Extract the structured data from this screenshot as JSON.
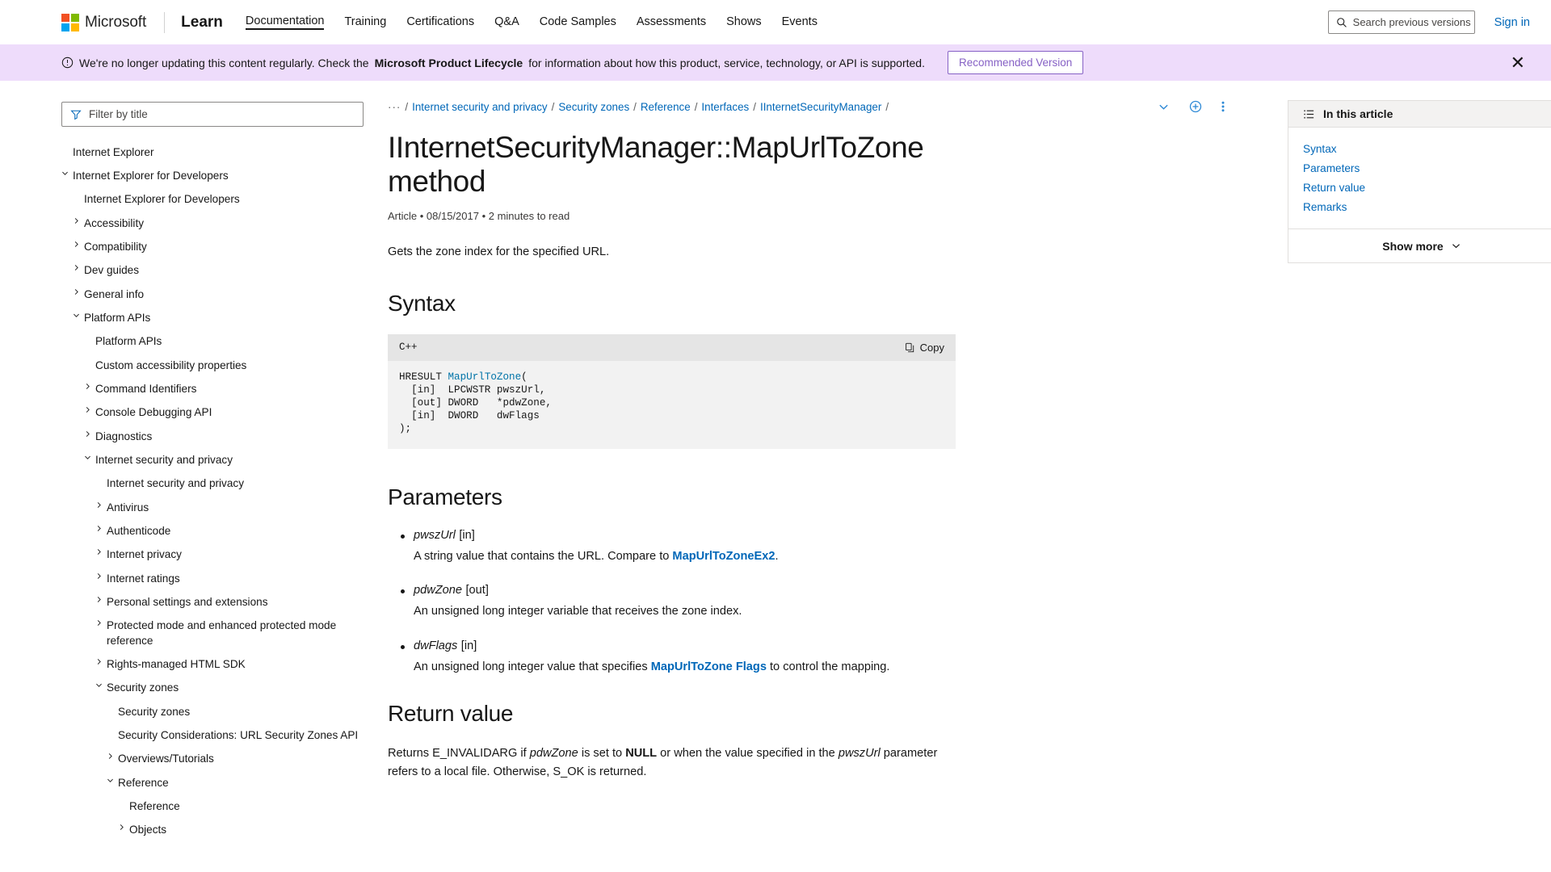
{
  "header": {
    "brand_name": "Microsoft",
    "product": "Learn",
    "logo_colors": [
      "#f25022",
      "#7fba00",
      "#00a4ef",
      "#ffb900"
    ],
    "nav": [
      {
        "label": "Documentation",
        "active": true
      },
      {
        "label": "Training",
        "active": false
      },
      {
        "label": "Certifications",
        "active": false
      },
      {
        "label": "Q&A",
        "active": false
      },
      {
        "label": "Code Samples",
        "active": false
      },
      {
        "label": "Assessments",
        "active": false
      },
      {
        "label": "Shows",
        "active": false
      },
      {
        "label": "Events",
        "active": false
      }
    ],
    "search_placeholder": "Search previous versions",
    "search_value": "",
    "sign_in": "Sign in"
  },
  "banner": {
    "text_before": "We're no longer updating this content regularly. Check the",
    "link": "Microsoft Product Lifecycle",
    "text_after": "for information about how this product, service, technology, or API is supported.",
    "button": "Recommended Version",
    "close": "✕",
    "background": "#eedcfb",
    "accent": "#8661c5"
  },
  "sidebar": {
    "filter_placeholder": "Filter by title",
    "filter_value": "",
    "items": [
      {
        "label": "Internet Explorer",
        "depth": 0,
        "chevron": "none"
      },
      {
        "label": "Internet Explorer for Developers",
        "depth": 0,
        "chevron": "down"
      },
      {
        "label": "Internet Explorer for Developers",
        "depth": 1,
        "chevron": "none"
      },
      {
        "label": "Accessibility",
        "depth": 1,
        "chevron": "right"
      },
      {
        "label": "Compatibility",
        "depth": 1,
        "chevron": "right"
      },
      {
        "label": "Dev guides",
        "depth": 1,
        "chevron": "right"
      },
      {
        "label": "General info",
        "depth": 1,
        "chevron": "right"
      },
      {
        "label": "Platform APIs",
        "depth": 1,
        "chevron": "down"
      },
      {
        "label": "Platform APIs",
        "depth": 2,
        "chevron": "none"
      },
      {
        "label": "Custom accessibility properties",
        "depth": 2,
        "chevron": "none"
      },
      {
        "label": "Command Identifiers",
        "depth": 2,
        "chevron": "right"
      },
      {
        "label": "Console Debugging API",
        "depth": 2,
        "chevron": "right"
      },
      {
        "label": "Diagnostics",
        "depth": 2,
        "chevron": "right"
      },
      {
        "label": "Internet security and privacy",
        "depth": 2,
        "chevron": "down"
      },
      {
        "label": "Internet security and privacy",
        "depth": 3,
        "chevron": "none"
      },
      {
        "label": "Antivirus",
        "depth": 3,
        "chevron": "right"
      },
      {
        "label": "Authenticode",
        "depth": 3,
        "chevron": "right"
      },
      {
        "label": "Internet privacy",
        "depth": 3,
        "chevron": "right"
      },
      {
        "label": "Internet ratings",
        "depth": 3,
        "chevron": "right"
      },
      {
        "label": "Personal settings and extensions",
        "depth": 3,
        "chevron": "right"
      },
      {
        "label": "Protected mode and enhanced protected mode reference",
        "depth": 3,
        "chevron": "right"
      },
      {
        "label": "Rights-managed HTML SDK",
        "depth": 3,
        "chevron": "right"
      },
      {
        "label": "Security zones",
        "depth": 3,
        "chevron": "down"
      },
      {
        "label": "Security zones",
        "depth": 4,
        "chevron": "none"
      },
      {
        "label": "Security Considerations: URL Security Zones API",
        "depth": 4,
        "chevron": "none"
      },
      {
        "label": "Overviews/Tutorials",
        "depth": 4,
        "chevron": "right"
      },
      {
        "label": "Reference",
        "depth": 4,
        "chevron": "down"
      },
      {
        "label": "Reference",
        "depth": 5,
        "chevron": "none"
      },
      {
        "label": "Objects",
        "depth": 5,
        "chevron": "right"
      }
    ]
  },
  "article": {
    "breadcrumb": {
      "ellipsis": "···",
      "separator": "/",
      "items": [
        "Internet security and privacy",
        "Security zones",
        "Reference",
        "Interfaces",
        "IInternetSecurityManager"
      ]
    },
    "title": "IInternetSecurityManager::MapUrlToZone method",
    "meta": "Article • 08/15/2017 • 2 minutes to read",
    "lead": "Gets the zone index for the specified URL.",
    "syntax": {
      "heading": "Syntax",
      "language": "C++",
      "copy_label": "Copy",
      "code_prefix": "HRESULT ",
      "code_fn": "MapUrlToZone",
      "code_rest": "(\n  [in]  LPCWSTR pwszUrl,\n  [out] DWORD   *pdwZone,\n  [in]  DWORD   dwFlags\n);"
    },
    "parameters": {
      "heading": "Parameters",
      "items": [
        {
          "name": "pwszUrl",
          "direction": "[in]",
          "desc_before": "A string value that contains the URL. Compare to ",
          "desc_link": "MapUrlToZoneEx2",
          "desc_after": "."
        },
        {
          "name": "pdwZone",
          "direction": "[out]",
          "desc_before": "An unsigned long integer variable that receives the zone index.",
          "desc_link": "",
          "desc_after": ""
        },
        {
          "name": "dwFlags",
          "direction": "[in]",
          "desc_before": "An unsigned long integer value that specifies ",
          "desc_link": "MapUrlToZone Flags",
          "desc_after": " to control the mapping."
        }
      ]
    },
    "return_value": {
      "heading": "Return value",
      "text_1": "Returns E_INVALIDARG if ",
      "em_1": "pdwZone",
      "text_2": " is set to ",
      "strong_1": "NULL",
      "text_3": " or when the value specified in the ",
      "em_2": "pwszUrl",
      "text_4": " parameter refers to a local file. Otherwise, S_OK is returned."
    }
  },
  "toc": {
    "heading": "In this article",
    "links": [
      "Syntax",
      "Parameters",
      "Return value",
      "Remarks"
    ],
    "show_more": "Show more"
  }
}
